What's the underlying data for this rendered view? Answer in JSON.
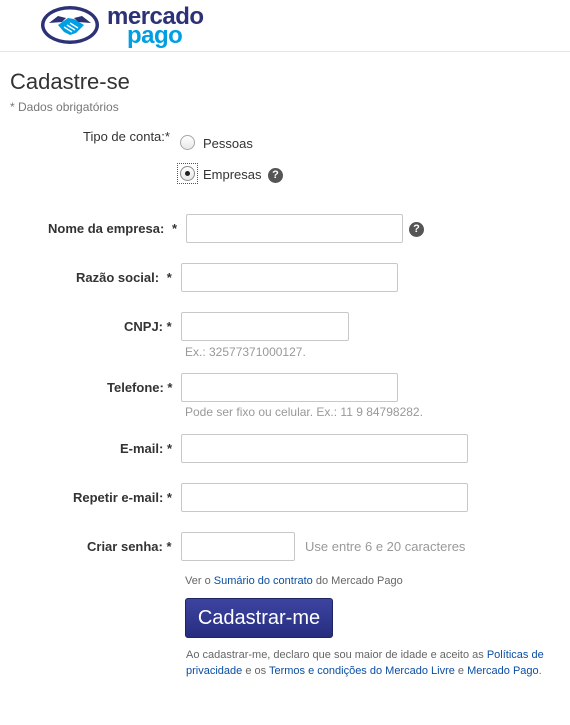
{
  "brand": {
    "line1": "mercado",
    "line2": "pago",
    "colors": {
      "navy": "#2d3277",
      "cyan": "#009ee3"
    }
  },
  "page": {
    "title": "Cadastre-se",
    "required_note": "* Dados obrigatórios"
  },
  "account_type": {
    "label": "Tipo de conta:*",
    "options": [
      {
        "label": "Pessoas",
        "checked": false
      },
      {
        "label": "Empresas",
        "checked": true
      }
    ],
    "help_icon": "question-circle-icon"
  },
  "fields": {
    "company_name": {
      "label": "Nome da empresa:",
      "required_mark": "*",
      "value": ""
    },
    "legal_name": {
      "label": "Razão social:",
      "required_mark": "*",
      "value": ""
    },
    "cnpj": {
      "label": "CNPJ: *",
      "value": "",
      "hint": "Ex.: 32577371000127."
    },
    "phone": {
      "label": "Telefone: *",
      "value": "",
      "hint": "Pode ser fixo ou celular. Ex.: 11 9 84798282."
    },
    "email": {
      "label": "E-mail: *",
      "value": ""
    },
    "email_repeat": {
      "label": "Repetir e-mail: *",
      "value": ""
    },
    "password": {
      "label": "Criar senha: *",
      "value": "",
      "hint": "Use entre 6 e 20 caracteres"
    }
  },
  "contract": {
    "prefix": "Ver o ",
    "link": "Sumário do contrato",
    "suffix": " do Mercado Pago"
  },
  "submit_label": "Cadastrar-me",
  "legal": {
    "prefix": "Ao cadastrar-me, declaro que sou maior de idade e aceito as ",
    "privacy_link": "Políticas de privacidade",
    "middle": " e os ",
    "terms_link": "Termos e condições do Mercado Livre",
    "and": " e ",
    "mp_link": "Mercado Pago",
    "end": "."
  }
}
